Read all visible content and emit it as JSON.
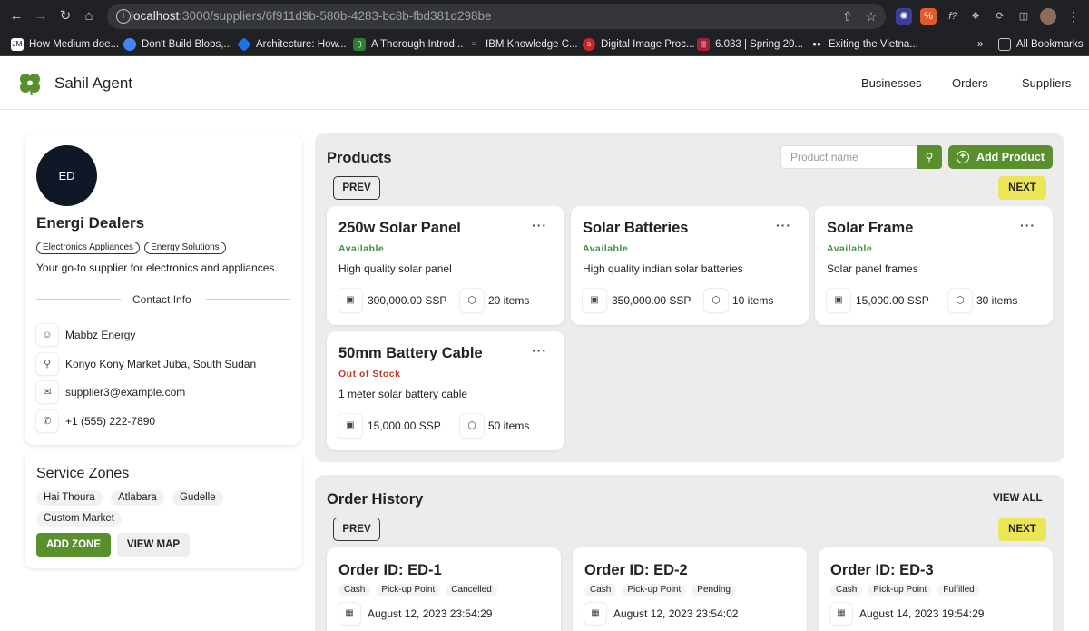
{
  "browser": {
    "url_host": "localhost",
    "url_rest": ":3000/suppliers/6f911d9b-580b-4283-bc8b-fbd381d298be",
    "bookmarks": [
      "How Medium doe...",
      "Don't Build Blobs,...",
      "Architecture: How...",
      "A Thorough Introd...",
      "IBM Knowledge C...",
      "Digital Image Proc...",
      "6.033 | Spring 20...",
      "Exiting the Vietna..."
    ],
    "more_label": "»",
    "all_bookmarks_label": "All Bookmarks"
  },
  "header": {
    "brand": "Sahil Agent",
    "nav": [
      "Businesses",
      "Orders",
      "Suppliers"
    ]
  },
  "supplier": {
    "avatar_initials": "ED",
    "name": "Energi Dealers",
    "tags": [
      "Electronics Appliances",
      "Energy Solutions"
    ],
    "description": "Your go-to supplier for electronics and appliances.",
    "contact_title": "Contact Info",
    "contact": {
      "person": "Mabbz Energy",
      "address": "Konyo Kony Market Juba, South Sudan",
      "email": "supplier3@example.com",
      "phone": "+1 (555) 222-7890"
    }
  },
  "zones": {
    "title": "Service Zones",
    "items": [
      "Hai Thoura",
      "Atlabara",
      "Gudelle",
      "Custom Market"
    ],
    "add_label": "ADD ZONE",
    "map_label": "VIEW MAP"
  },
  "products": {
    "title": "Products",
    "search_placeholder": "Product name",
    "add_label": "Add Product",
    "prev_label": "PREV",
    "next_label": "NEXT",
    "items": [
      {
        "name": "250w Solar Panel",
        "status": "Available",
        "description": "High quality solar panel",
        "price": "300,000.00 SSP",
        "quantity": "20 items"
      },
      {
        "name": "Solar Batteries",
        "status": "Available",
        "description": "High quality indian solar batteries",
        "price": "350,000.00 SSP",
        "quantity": "10 items"
      },
      {
        "name": "Solar Frame",
        "status": "Available",
        "description": "Solar panel frames",
        "price": "15,000.00 SSP",
        "quantity": "30 items"
      },
      {
        "name": "50mm Battery Cable",
        "status": "Out of Stock",
        "description": "1 meter solar battery cable",
        "price": "15,000.00 SSP",
        "quantity": "50 items"
      }
    ],
    "menu_label": "···"
  },
  "orders": {
    "title": "Order History",
    "view_all_label": "VIEW ALL",
    "prev_label": "PREV",
    "next_label": "NEXT",
    "items": [
      {
        "id": "Order ID: ED-1",
        "payment": "Cash",
        "delivery": "Pick-up Point",
        "status": "Cancelled",
        "date": "August 12, 2023 23:54:29"
      },
      {
        "id": "Order ID: ED-2",
        "payment": "Cash",
        "delivery": "Pick-up Point",
        "status": "Pending",
        "date": "August 12, 2023 23:54:02"
      },
      {
        "id": "Order ID: ED-3",
        "payment": "Cash",
        "delivery": "Pick-up Point",
        "status": "Fulfilled",
        "date": "August 14, 2023 19:54:29"
      }
    ]
  },
  "colors": {
    "primary_green": "#5a8f2e",
    "available_green": "#3f9142",
    "out_of_stock_red": "#c0392b",
    "next_yellow": "#ece556"
  }
}
